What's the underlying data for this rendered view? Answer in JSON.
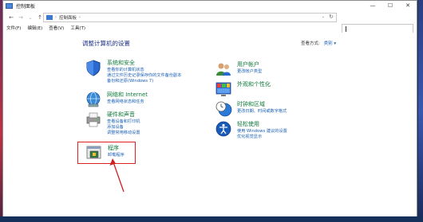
{
  "window": {
    "title": "控制面板"
  },
  "controls": {
    "minimize": "—",
    "maximize": "☐",
    "close": "✕"
  },
  "nav": {
    "back": "←",
    "forward": "→",
    "recent": "⌄",
    "up": "↑"
  },
  "address": {
    "breadcrumb": "控制面板",
    "separator": "›",
    "dropdown": "⌄",
    "refresh": "↻"
  },
  "menu": {
    "file": "文件(F)",
    "edit": "编辑(E)",
    "view": "查看(V)",
    "tools": "工具(T)"
  },
  "heading": "调整计算机的设置",
  "view_by": {
    "label": "查看方式:",
    "value": "类别 ▾"
  },
  "categories_left": [
    {
      "title": "系统和安全",
      "links": [
        "查看你的计算机状态",
        "通过文件历史记录保存你的文件备份副本",
        "备份和还原(Windows 7)"
      ]
    },
    {
      "title": "网络和 Internet",
      "links": [
        "查看网络状态和任务"
      ]
    },
    {
      "title": "硬件和声音",
      "links": [
        "查看设备和打印机",
        "添加设备",
        "调整常用移动设置"
      ]
    },
    {
      "title": "程序",
      "links": [
        "卸载程序"
      ]
    }
  ],
  "categories_right": [
    {
      "title": "用户帐户",
      "links": [
        "更改帐户类型"
      ]
    },
    {
      "title": "外观和个性化",
      "links": []
    },
    {
      "title": "时钟和区域",
      "links": [
        "更改日期、时间或数字格式"
      ]
    },
    {
      "title": "轻松使用",
      "links": [
        "使用 Windows 建议的设置",
        "优化视觉显示"
      ]
    }
  ]
}
